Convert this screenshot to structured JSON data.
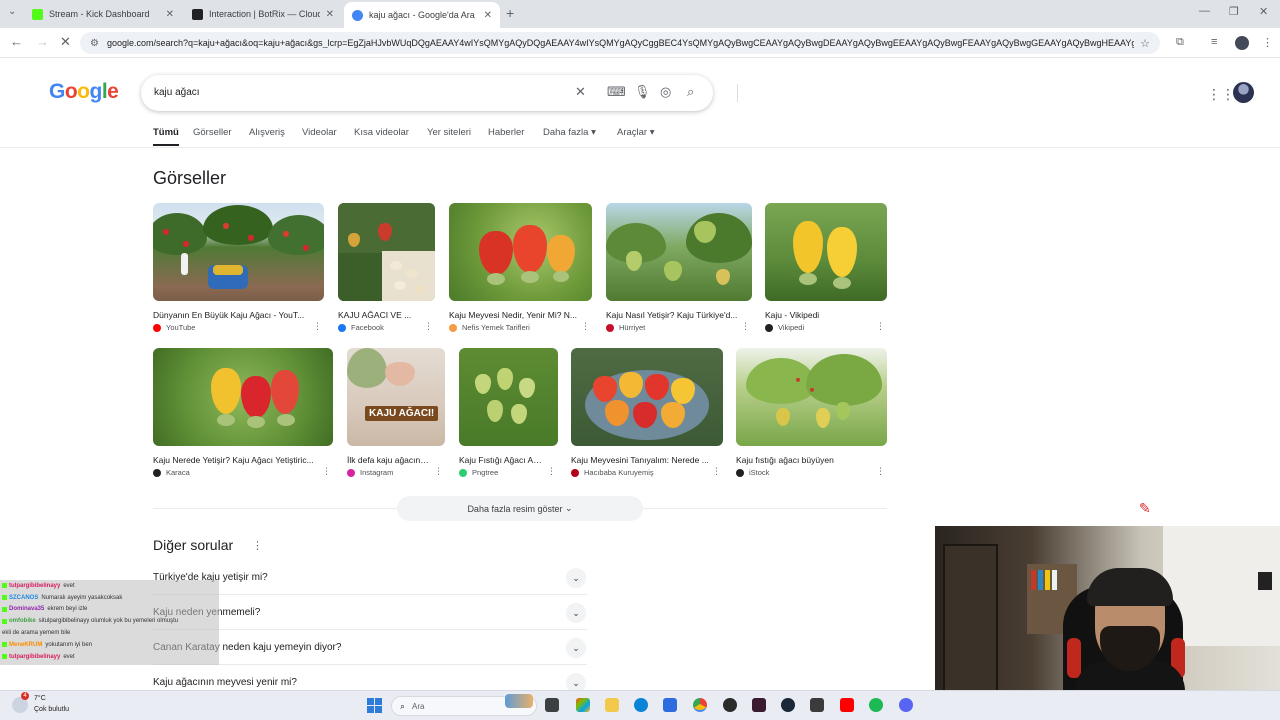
{
  "browser": {
    "tabs": [
      {
        "title": "Stream - Kick Dashboard",
        "favicon_color": "#53fc18",
        "active": false
      },
      {
        "title": "Interaction | BotRix — Cloud St",
        "favicon_color": "#202124",
        "active": false
      },
      {
        "title": "kaju ağacı - Google'da Ara",
        "favicon_color": "#4285f4",
        "active": true
      }
    ],
    "url": "google.com/search?q=kaju+ağacı&oq=kaju+ağacı&gs_lcrp=EgZjaHJvbWUqDQgAEAAY4wIYsQMYgAQyDQgAEAAY4wIYsQMYgAQyCggBEC4YsQMYgAQyBwgCEAAYgAQyBwgDEAAYgAQyBwgEEAAYgAQyBwgFEAAYgAQyBwgGEAAYgAQyBwgHEAAYgA..."
  },
  "google": {
    "logo": [
      "G",
      "o",
      "o",
      "g",
      "l",
      "e"
    ],
    "logo_colors": [
      "#4285f4",
      "#ea4335",
      "#fbbc05",
      "#4285f4",
      "#34a853",
      "#ea4335"
    ],
    "query": "kaju ağacı",
    "nav": [
      {
        "label": "Tümü",
        "active": true
      },
      {
        "label": "Görseller"
      },
      {
        "label": "Alışveriş"
      },
      {
        "label": "Videolar"
      },
      {
        "label": "Kısa videolar"
      },
      {
        "label": "Yer siteleri"
      },
      {
        "label": "Haberler"
      },
      {
        "label": "Daha fazla"
      },
      {
        "label": "Araçlar"
      }
    ]
  },
  "images": {
    "title": "Görseller",
    "items": [
      {
        "caption": "Dünyanın En Büyük Kaju Ağacı - YouT...",
        "source": "YouTube",
        "source_color": "#ff0000"
      },
      {
        "caption": "KAJU AĞACI VE ...",
        "source": "Facebook",
        "source_color": "#1877f2"
      },
      {
        "caption": "Kaju Meyvesi Nedir, Yenir Mi? N...",
        "source": "Nefis Yemek Tarifleri",
        "source_color": "#f59b42"
      },
      {
        "caption": "Kaju Nasıl Yetişir? Kaju Türkiye'd...",
        "source": "Hürriyet",
        "source_color": "#c8102e"
      },
      {
        "caption": "Kaju - Vikipedi",
        "source": "Vikipedi",
        "source_color": "#202124"
      },
      {
        "caption": "Kaju Nerede Yetişir? Kaju Ağacı Yetiştiric...",
        "source": "Karaca",
        "source_color": "#202124"
      },
      {
        "caption": "İlk defa kaju ağacının...",
        "source": "Instagram",
        "source_color": "#d6249f"
      },
      {
        "caption": "Kaju Fıstığı Ağacı Asıl...",
        "source": "Pngtree",
        "source_color": "#2ecc71"
      },
      {
        "caption": "Kaju Meyvesini Tanıyalım: Nerede ...",
        "source": "Hacıbaba Kuruyemiş",
        "source_color": "#b3001b"
      },
      {
        "caption": "Kaju fıstığı ağacı büyüyen",
        "source": "iStock",
        "source_color": "#202124"
      }
    ],
    "banner_text": "KAJU AĞACI!",
    "show_more": "Daha fazla resim göster"
  },
  "questions": {
    "title": "Diğer sorular",
    "items": [
      "Türkiye'de kaju yetişir mi?",
      "Kaju neden yenmemeli?",
      "Canan Karatay neden kaju yemeyin diyor?",
      "Kaju ağacının meyvesi yenir mi?"
    ]
  },
  "chat": [
    {
      "user": "tulpargibibelinayy",
      "msg": "evet",
      "user_color": "#d81b60"
    },
    {
      "user": "SZCANOS",
      "msg": "Numaralı ayeyim yasakcoksak",
      "user_color": "#1e88e5"
    },
    {
      "user": "Dominava35",
      "msg": "ekrem beyi izle",
      "user_color": "#8e24aa"
    },
    {
      "user": "omfobike",
      "msg": "situlpargibibelinayy olumluk yok bu yemeleri olmuştu",
      "user_color": "#43a047"
    },
    {
      "user": "",
      "msg": "ekli de arama yemem bile",
      "user_color": "#333333"
    },
    {
      "user": "MeneKRUM",
      "msg": "yokutanım iyi ben",
      "user_color": "#fb8c00"
    },
    {
      "user": "tulpargibibelinayy",
      "msg": "evet",
      "user_color": "#d81b60"
    }
  ],
  "taskbar": {
    "weather_temp": "7°C",
    "weather_desc": "Çok bulutlu",
    "weather_badge": "4",
    "search_placeholder": "Ara"
  }
}
